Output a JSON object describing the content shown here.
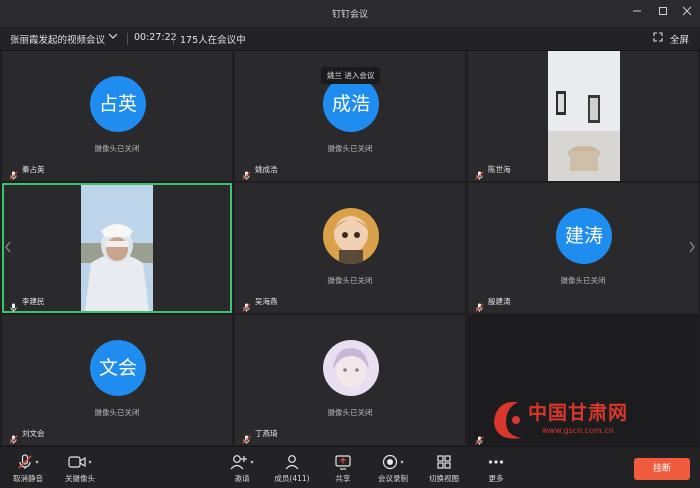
{
  "window": {
    "title": "钉钉会议",
    "minimize_icon": "minimize-icon",
    "maximize_icon": "maximize-icon",
    "close_icon": "close-icon"
  },
  "infobar": {
    "meeting_name": "张丽霞发起的视频会议",
    "duration": "00:27:22",
    "participants_in_meeting": "175人在会议中",
    "fullscreen_label": "全屏"
  },
  "toast": {
    "text": "姚兰 进入会议"
  },
  "camera_off_text": "摄像头已关闭",
  "tiles": [
    {
      "name": "秦占英",
      "avatar_text": "占英"
    },
    {
      "name": "姚成浩",
      "avatar_text": "成浩"
    },
    {
      "name": "陈世海"
    },
    {
      "name": "李建民"
    },
    {
      "name": "吴海燕"
    },
    {
      "name": "殷建涛",
      "avatar_text": "建涛"
    },
    {
      "name": "刘文会",
      "avatar_text": "文会"
    },
    {
      "name": "丁燕琦"
    },
    {
      "name": ""
    }
  ],
  "toolbar": {
    "unmute": "取消静音",
    "camera_off": "关摄像头",
    "invite": "邀请",
    "members": "成员(411)",
    "share": "共享",
    "record": "会议录制",
    "switch_view": "切换视图",
    "more": "更多",
    "hangup": "挂断"
  },
  "watermark": {
    "brand": "中国甘肃网",
    "url": "www.gscn.com.cn"
  },
  "colors": {
    "avatar_blue": "#1f8cf0",
    "active_border": "#3cc36b",
    "hangup_red": "#ef5b3c",
    "muted_red": "#e84c3d"
  }
}
